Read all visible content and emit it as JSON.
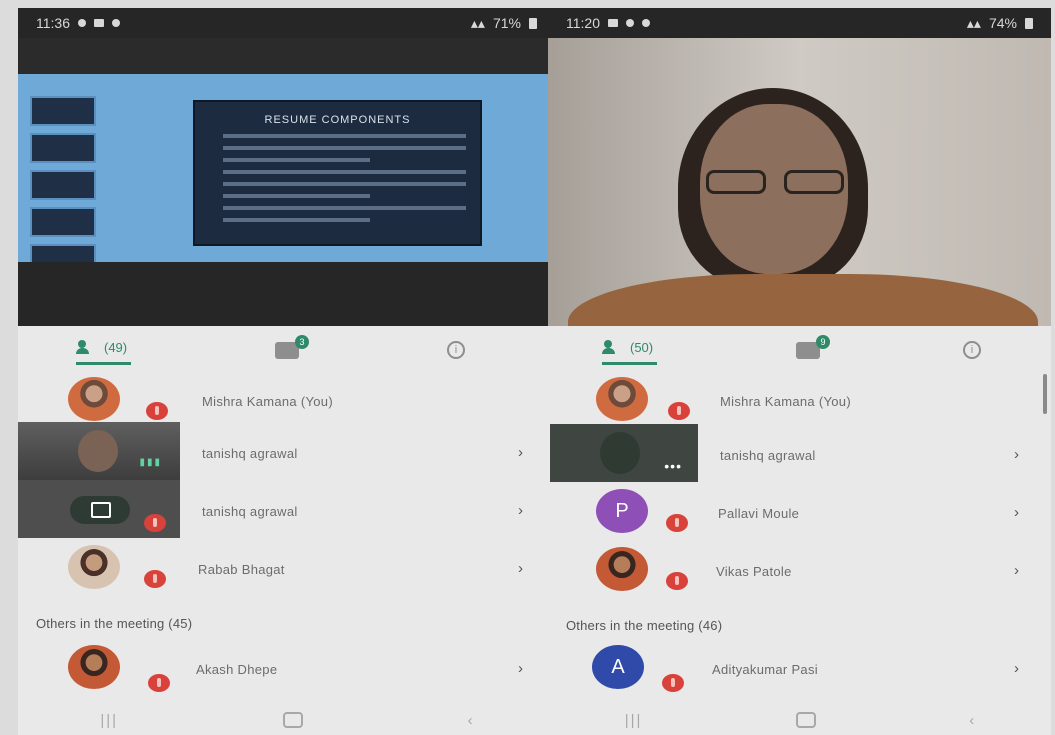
{
  "left": {
    "status": {
      "time": "11:36",
      "battery": "71%"
    },
    "slide_title": "RESUME COMPONENTS",
    "tabs": {
      "people_count": "(49)",
      "chat_badge": "3"
    },
    "participants": [
      {
        "name": "Mishra Kamana (You)"
      },
      {
        "name": "tanishq agrawal"
      },
      {
        "name": "tanishq agrawal"
      },
      {
        "name": "Rabab Bhagat"
      }
    ],
    "others_label": "Others in the meeting (45)",
    "others": [
      {
        "name": "Akash Dhepe"
      }
    ]
  },
  "right": {
    "status": {
      "time": "11:20",
      "battery": "74%"
    },
    "tabs": {
      "people_count": "(50)",
      "chat_badge": "9"
    },
    "participants": [
      {
        "name": "Mishra Kamana (You)"
      },
      {
        "name": "tanishq agrawal"
      },
      {
        "name": "Pallavi Moule",
        "initial": "P",
        "color": "#8e4fb6"
      },
      {
        "name": "Vikas Patole"
      }
    ],
    "others_label": "Others in the meeting (46)",
    "others": [
      {
        "name": "Adityakumar Pasi",
        "initial": "A",
        "color": "#2f4aa8"
      }
    ]
  },
  "icons": {
    "chevron": "›",
    "info": "i",
    "nav_recent": "|||",
    "nav_back": "‹"
  }
}
